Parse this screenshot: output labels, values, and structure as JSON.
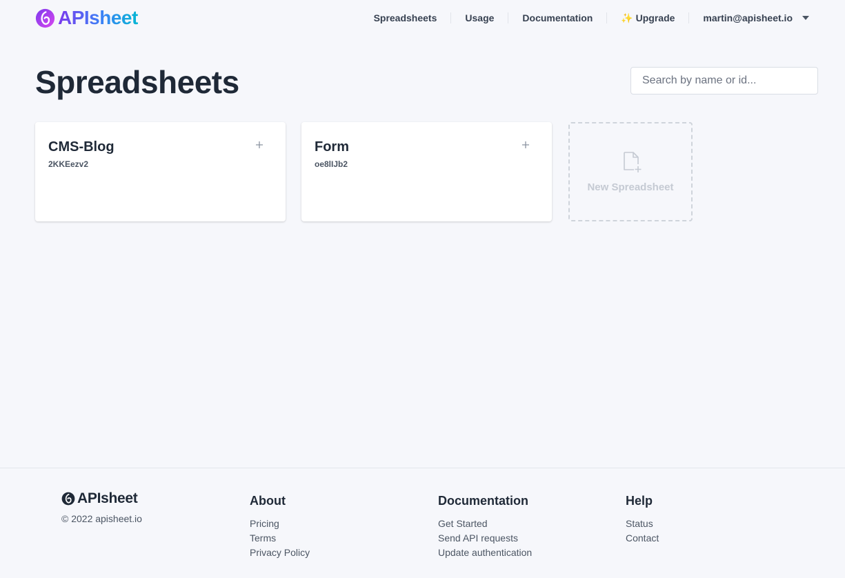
{
  "brand": {
    "name": "APIsheet"
  },
  "nav": {
    "items": [
      {
        "label": "Spreadsheets"
      },
      {
        "label": "Usage"
      },
      {
        "label": "Documentation"
      },
      {
        "label": "✨ Upgrade"
      }
    ],
    "user": "martin@apisheet.io"
  },
  "page": {
    "title": "Spreadsheets",
    "search_placeholder": "Search by name or id..."
  },
  "spreadsheets": [
    {
      "name": "CMS-Blog",
      "id": "2KKEezv2"
    },
    {
      "name": "Form",
      "id": "oe8lIJb2"
    }
  ],
  "new_spreadsheet": {
    "label": "New Spreadsheet"
  },
  "footer": {
    "brand": "APIsheet",
    "copyright": "© 2022 apisheet.io",
    "columns": [
      {
        "title": "About",
        "links": [
          "Pricing",
          "Terms",
          "Privacy Policy"
        ]
      },
      {
        "title": "Documentation",
        "links": [
          "Get Started",
          "Send API requests",
          "Update authentication"
        ]
      },
      {
        "title": "Help",
        "links": [
          "Status",
          "Contact"
        ]
      }
    ]
  },
  "colors": {
    "background": "#f6f7fb",
    "brand_gradient_start": "#7c3aed",
    "brand_gradient_end": "#06b6d4",
    "text_dark": "#1f2937"
  }
}
